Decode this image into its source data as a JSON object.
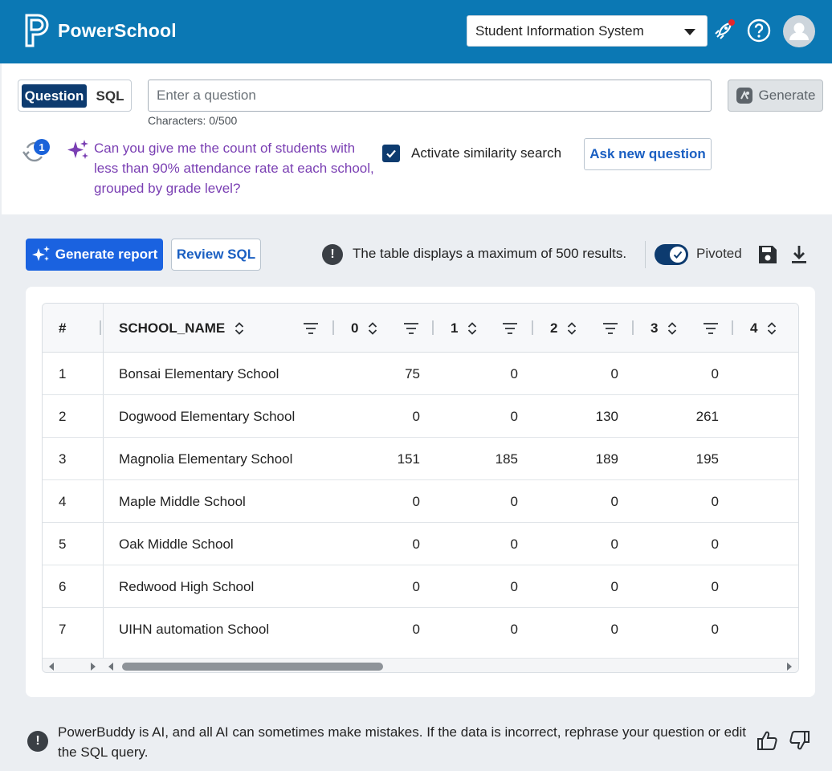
{
  "header": {
    "brand": "PowerSchool",
    "app_select": "Student Information System",
    "icons": [
      "rocket-icon",
      "help-icon",
      "user-avatar-icon"
    ],
    "brand_color": "#0b78b4"
  },
  "question_panel": {
    "mode_question": "Question",
    "mode_sql": "SQL",
    "input_placeholder": "Enter a question",
    "char_count": "Characters: 0/500",
    "generate_label": "Generate",
    "history_badge": "1",
    "previous_question": "Can you give me the count of students with less than 90% attendance rate at each school, grouped by grade level?",
    "similarity_label": "Activate similarity search",
    "similarity_checked": true,
    "ask_new_label": "Ask new question"
  },
  "toolbar": {
    "generate_report_label": "Generate report",
    "review_sql_label": "Review SQL",
    "info_glyph": "!",
    "max_results_note": "The table displays a maximum of 500 results.",
    "pivoted_label": "Pivoted",
    "pivoted_on": true
  },
  "table": {
    "headers": [
      "#",
      "SCHOOL_NAME",
      "0",
      "1",
      "2",
      "3",
      "4"
    ],
    "rows": [
      {
        "idx": "1",
        "school": "Bonsai Elementary School",
        "c0": "75",
        "c1": "0",
        "c2": "0",
        "c3": "0"
      },
      {
        "idx": "2",
        "school": "Dogwood Elementary School",
        "c0": "0",
        "c1": "0",
        "c2": "130",
        "c3": "261"
      },
      {
        "idx": "3",
        "school": "Magnolia Elementary School",
        "c0": "151",
        "c1": "185",
        "c2": "189",
        "c3": "195"
      },
      {
        "idx": "4",
        "school": "Maple Middle School",
        "c0": "0",
        "c1": "0",
        "c2": "0",
        "c3": "0"
      },
      {
        "idx": "5",
        "school": "Oak Middle School",
        "c0": "0",
        "c1": "0",
        "c2": "0",
        "c3": "0"
      },
      {
        "idx": "6",
        "school": "Redwood High School",
        "c0": "0",
        "c1": "0",
        "c2": "0",
        "c3": "0"
      },
      {
        "idx": "7",
        "school": "UIHN automation School",
        "c0": "0",
        "c1": "0",
        "c2": "0",
        "c3": "0"
      }
    ]
  },
  "footer": {
    "disclaimer": "PowerBuddy is AI, and all AI can sometimes make mistakes. If the data is incorrect, rephrase your question or edit the SQL query."
  }
}
